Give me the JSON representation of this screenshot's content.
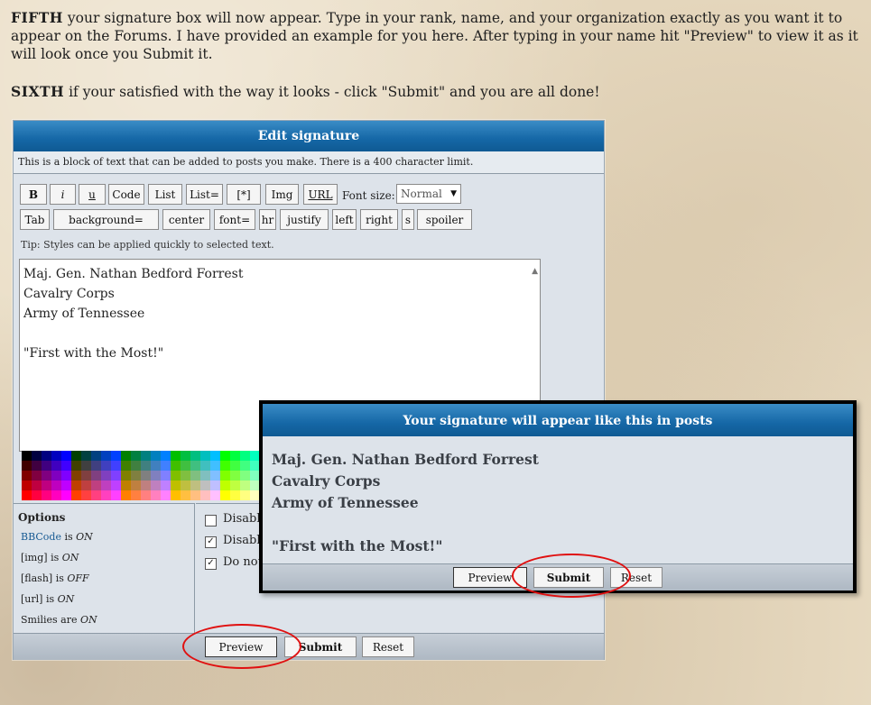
{
  "instructions": {
    "step5_label": "FIFTH",
    "step5_text": " your signature box will now appear. Type in your rank, name, and your organization exactly as you want it to appear on the Forums. I have provided an example for you here. After typing in your name hit \"Preview\" to view it as it will look once you Submit it.",
    "step6_label": "SIXTH",
    "step6_text": " if your satisfied with the way it looks - click \"Submit\" and you are all done!"
  },
  "editor": {
    "title": "Edit signature",
    "description": "This is a block of text that can be added to posts you make. There is a 400 character limit.",
    "toolbar_row1": [
      "B",
      "i",
      "u",
      "Code",
      "List",
      "List=",
      "[*]",
      "Img",
      "URL"
    ],
    "toolbar_row2": [
      "Tab",
      "background=",
      "center",
      "font=",
      "hr",
      "justify",
      "left",
      "right",
      "s",
      "spoiler"
    ],
    "font_size_label": "Font size:",
    "font_size_value": "Normal",
    "tip": "Tip: Styles can be applied quickly to selected text.",
    "signature_lines": [
      "Maj. Gen.  Nathan Bedford Forrest",
      "Cavalry Corps",
      "Army of Tennessee",
      "",
      "\"First with the Most!\""
    ],
    "options": {
      "heading": "Options",
      "bbcode_link": "BBCode",
      "bbcode_state": "ON",
      "img_label": "[img]",
      "img_state": "ON",
      "flash_label": "[flash]",
      "flash_state": "OFF",
      "url_label": "[url]",
      "url_state": "ON",
      "smilies_label": "Smilies are",
      "smilies_state": "ON",
      "is_word": "is",
      "are_word": "are"
    },
    "checkboxes": [
      {
        "label": "Disable",
        "checked": false
      },
      {
        "label": "Disable",
        "checked": true
      },
      {
        "label": "Do not",
        "checked": true
      }
    ],
    "buttons": {
      "preview": "Preview",
      "submit": "Submit",
      "reset": "Reset"
    }
  },
  "preview_popup": {
    "title": "Your signature will appear like this in posts",
    "lines": [
      "Maj. Gen. Nathan Bedford Forrest",
      "Cavalry Corps",
      "Army of Tennessee",
      "",
      "\"First with the Most!\""
    ],
    "buttons": {
      "preview": "Preview",
      "submit": "Submit",
      "reset": "Reset"
    }
  },
  "palette_colors": [
    "#000000",
    "#000040",
    "#000080",
    "#0000bf",
    "#0000ff",
    "#004000",
    "#004040",
    "#004080",
    "#0040bf",
    "#0040ff",
    "#008000",
    "#008040",
    "#008080",
    "#0080bf",
    "#0080ff",
    "#00bf00",
    "#00bf40",
    "#00bf80",
    "#00bfbf",
    "#00bfff",
    "#00ff00",
    "#00ff40",
    "#00ff80",
    "#00ffbf",
    "#400000",
    "#400040",
    "#400080",
    "#4000bf",
    "#4000ff",
    "#404000",
    "#404040",
    "#404080",
    "#4040bf",
    "#4040ff",
    "#408000",
    "#408040",
    "#408080",
    "#4080bf",
    "#4080ff",
    "#40bf00",
    "#40bf40",
    "#40bf80",
    "#40bfbf",
    "#40bfff",
    "#40ff00",
    "#40ff40",
    "#40ff80",
    "#40ffbf",
    "#800000",
    "#800040",
    "#800080",
    "#8000bf",
    "#8000ff",
    "#804000",
    "#804040",
    "#804080",
    "#8040bf",
    "#8040ff",
    "#808000",
    "#808040",
    "#808080",
    "#8080bf",
    "#8080ff",
    "#80bf00",
    "#80bf40",
    "#80bf80",
    "#80bfbf",
    "#80bfff",
    "#80ff00",
    "#80ff40",
    "#80ff80",
    "#80ffbf",
    "#bf0000",
    "#bf0040",
    "#bf0080",
    "#bf00bf",
    "#bf00ff",
    "#bf4000",
    "#bf4040",
    "#bf4080",
    "#bf40bf",
    "#bf40ff",
    "#bf8000",
    "#bf8040",
    "#bf8080",
    "#bf80bf",
    "#bf80ff",
    "#bfbf00",
    "#bfbf40",
    "#bfbf80",
    "#bfbfbf",
    "#bfbfff",
    "#bfff00",
    "#bfff40",
    "#bfff80",
    "#bfffbf",
    "#ff0000",
    "#ff0040",
    "#ff0080",
    "#ff00bf",
    "#ff00ff",
    "#ff4000",
    "#ff4040",
    "#ff4080",
    "#ff40bf",
    "#ff40ff",
    "#ff8000",
    "#ff8040",
    "#ff8080",
    "#ff80bf",
    "#ff80ff",
    "#ffbf00",
    "#ffbf40",
    "#ffbf80",
    "#ffbfbf",
    "#ffbfff",
    "#ffff00",
    "#ffff40",
    "#ffff80",
    "#ffffbf"
  ],
  "annotation_color": "#e01010"
}
